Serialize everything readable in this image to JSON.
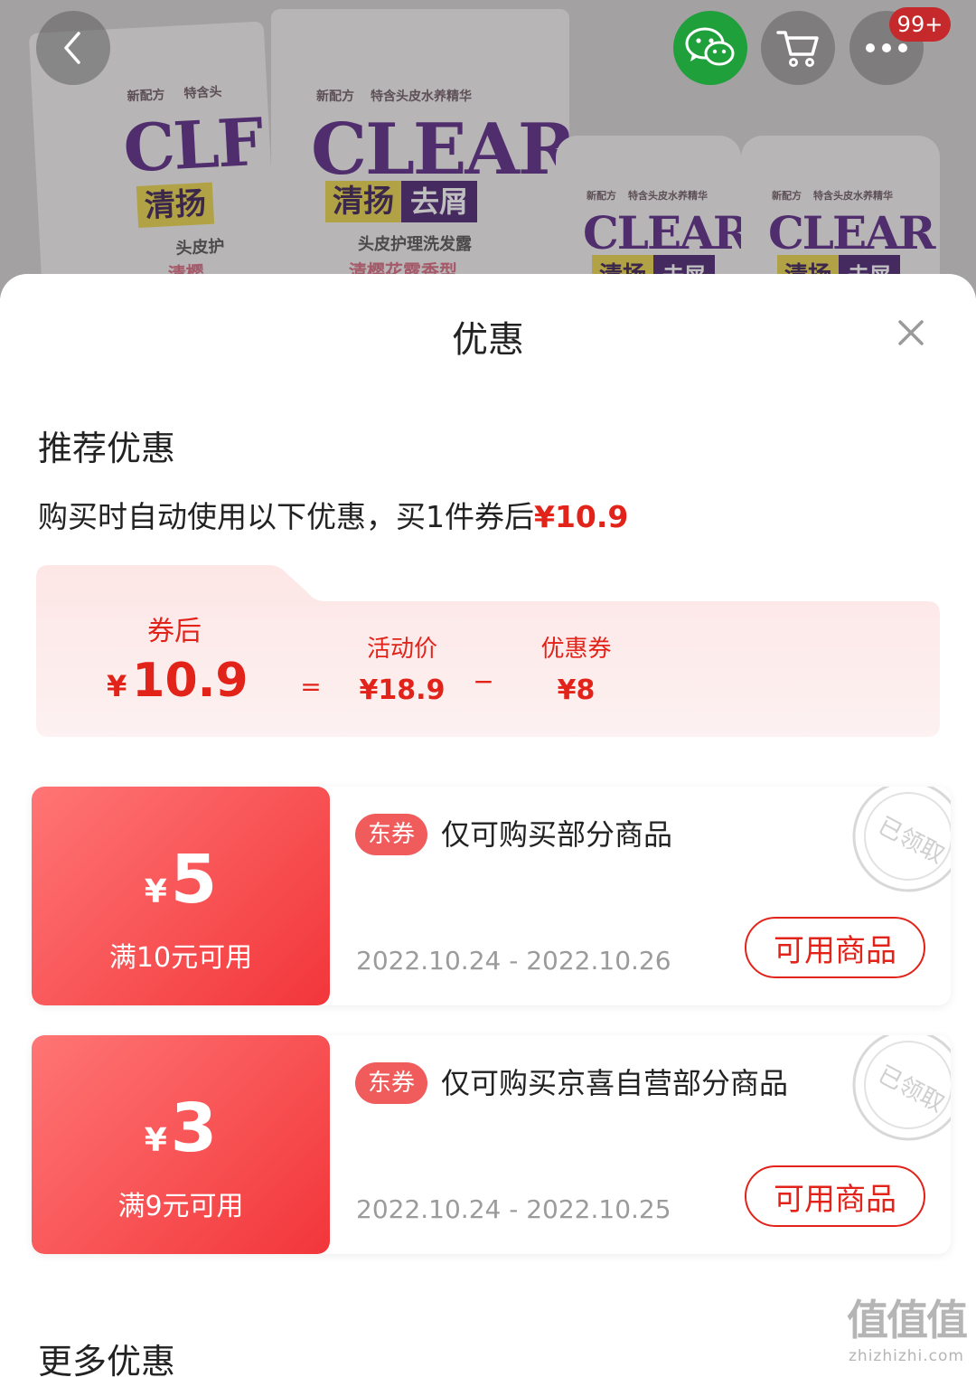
{
  "product": {
    "packs": [
      {
        "tag": "新配方",
        "tag2": "特含头",
        "brand": "CLF",
        "cn1": "清扬",
        "cn2": "",
        "sub": "头皮护",
        "pink": "清樱"
      },
      {
        "tag": "新配方",
        "tag2": "特含头皮水养精华",
        "brand": "CLEAR",
        "cn1": "清扬",
        "cn2": "去屑",
        "sub": "头皮护理洗发露",
        "pink": "清樱花露香型"
      },
      {
        "tag": "新配方",
        "tag2": "特含头皮水养精华",
        "brand": "CLEAR",
        "cn1": "清扬",
        "cn2": "去屑",
        "sub": "",
        "pink": ""
      },
      {
        "tag": "新配方",
        "tag2": "特含头皮水养精华",
        "brand": "CLEAR",
        "cn1": "清扬",
        "cn2": "去屑",
        "sub": "",
        "pink": ""
      }
    ]
  },
  "top_bar": {
    "badge": "99+",
    "icons": {
      "back": "chevron-left-icon",
      "wechat": "wechat-icon",
      "cart": "cart-icon",
      "more": "more-dots-icon"
    }
  },
  "sheet": {
    "title": "优惠",
    "close_icon": "close-icon"
  },
  "recommended": {
    "title": "推荐优惠",
    "desc_prefix": "购买时自动使用以下优惠，买1件券后",
    "desc_price": "¥10.9"
  },
  "summary": {
    "after_label": "券后",
    "after_yen": "¥",
    "after_value": "10.9",
    "eq": "=",
    "activity_label": "活动价",
    "activity_value": "¥18.9",
    "minus": "−",
    "coupon_label": "优惠券",
    "coupon_value": "¥8"
  },
  "coupons": [
    {
      "yen": "¥",
      "amount": "5",
      "condition": "满10元可用",
      "tag": "东券",
      "desc": "仅可购买部分商品",
      "date": "2022.10.24 - 2022.10.26",
      "button": "可用商品",
      "stamp": "已领取"
    },
    {
      "yen": "¥",
      "amount": "3",
      "condition": "满9元可用",
      "tag": "东券",
      "desc": "仅可购买京喜自营部分商品",
      "date": "2022.10.24 - 2022.10.25",
      "button": "可用商品",
      "stamp": "已领取"
    }
  ],
  "more": {
    "title": "更多优惠"
  },
  "watermark": {
    "logo": "值值值",
    "url": "zhizhizhi.com"
  },
  "colors": {
    "accent_red": "#e2231a",
    "coupon_gradient_start": "#ff7575",
    "coupon_gradient_end": "#f2363a",
    "summary_bg": "#fdeeee",
    "wechat_green": "#1fa03b"
  }
}
